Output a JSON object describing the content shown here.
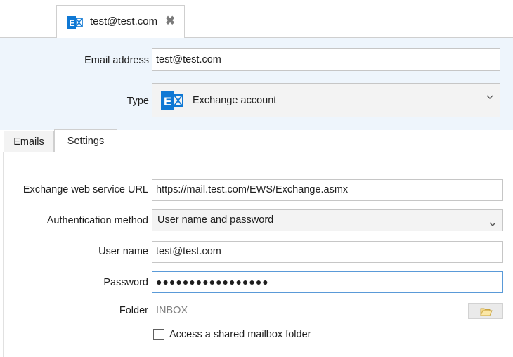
{
  "tab": {
    "title": "test@test.com",
    "icon": "exchange-icon",
    "close_icon": "close-icon",
    "close_glyph": "✖"
  },
  "account": {
    "email_label": "Email address",
    "email_value": "test@test.com",
    "type_label": "Type",
    "type_value": "Exchange account",
    "type_icon": "exchange-icon"
  },
  "tabs": [
    {
      "label": "Emails",
      "selected": false
    },
    {
      "label": "Settings",
      "selected": true
    }
  ],
  "settings": {
    "ews_label": "Exchange web service URL",
    "ews_value": "https://mail.test.com/EWS/Exchange.asmx",
    "auth_label": "Authentication method",
    "auth_value": "User name and password",
    "username_label": "User name",
    "username_value": "test@test.com",
    "password_label": "Password",
    "password_value": "●●●●●●●●●●●●●●●●●",
    "folder_label": "Folder",
    "folder_value": "INBOX",
    "folder_browse_icon": "folder-open-icon",
    "shared_label": "Access a shared mailbox folder",
    "shared_checked": false
  },
  "colors": {
    "header_bg": "#eef5fc",
    "exchange_blue": "#0f78d4",
    "focus_border": "#5a9ad8"
  }
}
